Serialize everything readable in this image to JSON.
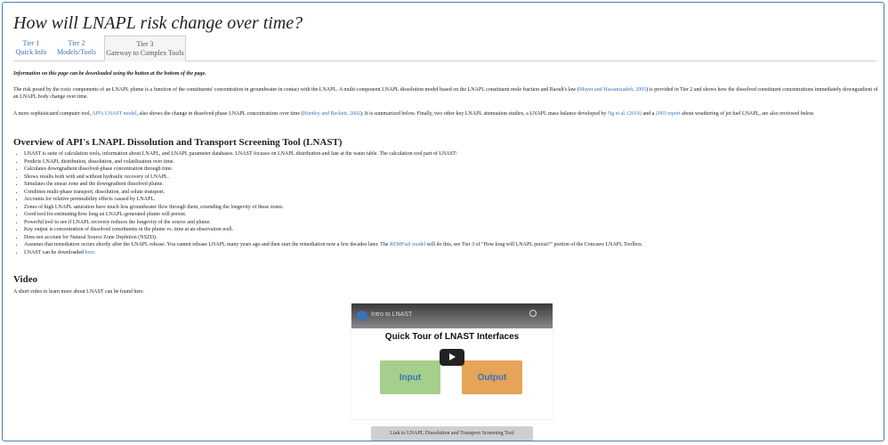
{
  "page_title": "How will LNAPL risk change over time?",
  "tabs": [
    {
      "line1": "Tier 1",
      "line2": "Quick Info"
    },
    {
      "line1": "Tier 2",
      "line2": "Models/Tools"
    },
    {
      "line1": "Tier 3",
      "line2": "Gateway to Complex Tools"
    }
  ],
  "notice": "Information on this page can be downloaded using the button at the bottom of the page.",
  "para1": {
    "before": "The risk posed by the toxic components of an LNAPL plume is a function of the constituents' concentration in groundwater in contact with the LNAPL. A multi-component LNAPL dissolution model based on the LNAPL constituent mole fraction and Raoult's law (",
    "link": "Mayer and Hassanizadeh, 2005",
    "after": ") is provided in Tier 2 and shows how the dissolved constituent concentrations immediately downgradient of an LNAPL body change over time."
  },
  "para2": {
    "t1": "A more sophisticated computer tool, ",
    "l1": "API's LNAST model",
    "t2": ", also shows the change in dissolved phase LNAPL concentrations over time (",
    "l2": "Huntley and Beckett, 2002",
    "t3": "). It is summarized below. Finally, two other key LNAPL attenuation studies, a LNAPL mass balance developed by ",
    "l3": "Ng et al. (2014)",
    "t4": " and a ",
    "l4": "2003 report",
    "t5": " about weathering of jet fuel LNAPL, are also reviewed below."
  },
  "overview_heading": "Overview of API's LNAPL Dissolution and Transport Screening Tool (LNAST)",
  "bullets": [
    "LNAST is suite of calculation tools, information about LNAPL, and LNAPL parameter databases. LNAST focuses on LNAPL distribution and fate at the water table. The calculation tool part of LNAST:",
    "Predicts LNAPL distribution, dissolution, and volatilization over time.",
    "Calculates downgradient dissolved-phase concentration through time.",
    "Shows results both with and without hydraulic recovery of LNAPL.",
    "Simulates the smear zone and the downgradient dissolved plume.",
    "Combines multi-phase transport, dissolution, and solute transport.",
    "Accounts for relative permeability effects caused by LNAPL.",
    "Zones of high LNAPL saturation have much less groundwater flow through them, extending the longevity of these zones.",
    "Good tool for estimating how long an LNAPL-generated plume will persist.",
    "Powerful tool to see if LNAPL recovery reduces the longevity of the source and plume.",
    "Key output is concentration of dissolved constituents in the plume vs. time at an observation well.",
    "Does not account for Natural Source Zone Depletion (NSZD)."
  ],
  "bullet_remfuel": {
    "before": "Assumes that remediation occurs shortly after the LNAPL release. You cannot release LNAPL many years ago and then start the remediation now a few decades later. The ",
    "link": "REMFuel model",
    "after": " will do this, see Tier 3 of \"How long will LNAPL persist?\" portion of the Concawe LNAPL Toolbox."
  },
  "bullet_download": {
    "before": "LNAST can be downloaded ",
    "link": "here",
    "after": "."
  },
  "video_heading": "Video",
  "video_intro": "A short video to learn more about LNAST can be found here.",
  "video": {
    "title": "Intro to LNAST",
    "heading": "Quick Tour of LNAST Interfaces",
    "input_label": "Input",
    "output_label": "Output"
  },
  "link_button": "Link to LNAPL Dissolution and Transport Screening Tool",
  "colors": {
    "link": "#3a73b8",
    "input_box": "#a6cf8c",
    "output_box": "#e5a458",
    "frame": "#4a7fb8"
  }
}
